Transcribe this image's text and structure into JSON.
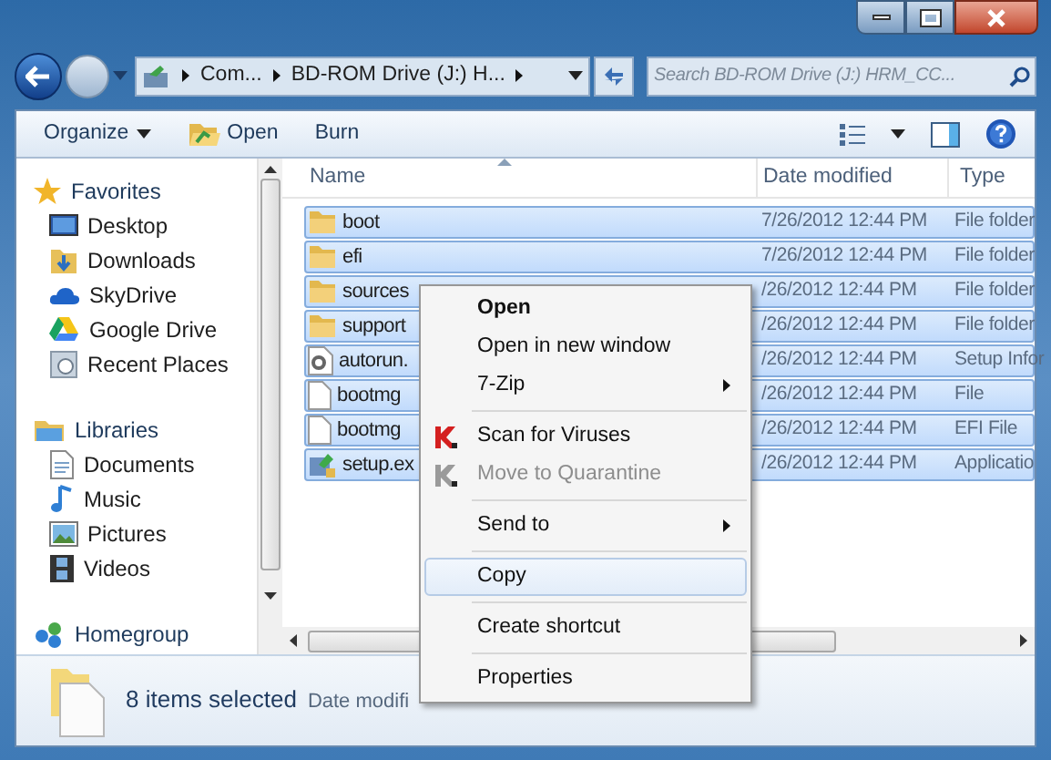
{
  "address": {
    "crumbs": [
      "Com...",
      "BD-ROM Drive (J:) H..."
    ]
  },
  "search": {
    "placeholder": "Search BD-ROM Drive (J:) HRM_CC..."
  },
  "toolbar": {
    "buttons": [
      {
        "label": "Organize",
        "kind": "dropdown"
      },
      {
        "label": "Open",
        "kind": "open"
      },
      {
        "label": "Burn",
        "kind": "plain"
      }
    ]
  },
  "sidebar": {
    "groups": [
      {
        "label": "Favorites",
        "kind": "star",
        "items": [
          {
            "label": "Desktop",
            "kind": "desktop"
          },
          {
            "label": "Downloads",
            "kind": "downloads"
          },
          {
            "label": "SkyDrive",
            "kind": "cloud"
          },
          {
            "label": "Google Drive",
            "kind": "drive"
          },
          {
            "label": "Recent Places",
            "kind": "recent"
          }
        ]
      },
      {
        "label": "Libraries",
        "kind": "library",
        "items": [
          {
            "label": "Documents",
            "kind": "document"
          },
          {
            "label": "Music",
            "kind": "music"
          },
          {
            "label": "Pictures",
            "kind": "pictures"
          },
          {
            "label": "Videos",
            "kind": "videos"
          }
        ]
      },
      {
        "label": "Homegroup",
        "kind": "homegroup"
      }
    ]
  },
  "table": {
    "columns": [
      "Name",
      "Date modified",
      "Type"
    ],
    "rows": [
      {
        "name": "boot",
        "date": "7/26/2012 12:44 PM",
        "type": "File folder",
        "kind": "folder",
        "selected": true
      },
      {
        "name": "efi",
        "date": "7/26/2012 12:44 PM",
        "type": "File folder",
        "kind": "folder",
        "selected": true
      },
      {
        "name": "sources",
        "date": "/26/2012 12:44 PM",
        "type": "File folder",
        "kind": "folder",
        "selected": true
      },
      {
        "name": "support",
        "date": "/26/2012 12:44 PM",
        "type": "File folder",
        "kind": "folder",
        "selected": true
      },
      {
        "name": "autorun.",
        "date": "/26/2012 12:44 PM",
        "type": "Setup Infor",
        "kind": "settings",
        "selected": true
      },
      {
        "name": "bootmg",
        "date": "/26/2012 12:44 PM",
        "type": "File",
        "kind": "file",
        "selected": true
      },
      {
        "name": "bootmg",
        "date": "/26/2012 12:44 PM",
        "type": "EFI File",
        "kind": "file",
        "selected": true
      },
      {
        "name": "setup.ex",
        "date": "/26/2012 12:44 PM",
        "type": "Applicatio",
        "kind": "setup",
        "selected": true
      }
    ]
  },
  "context_menu": {
    "groups": [
      [
        {
          "label": "Open",
          "bold": true,
          "disabled": false,
          "submenu": false,
          "selected": false
        },
        {
          "label": "Open in new window",
          "bold": false,
          "disabled": false,
          "submenu": false,
          "selected": false
        },
        {
          "label": "7-Zip",
          "bold": false,
          "disabled": false,
          "submenu": true,
          "selected": false
        }
      ],
      [
        {
          "label": "Scan for Viruses",
          "bold": false,
          "disabled": false,
          "submenu": false,
          "selected": false,
          "kind": "shield"
        },
        {
          "label": "Move to Quarantine",
          "bold": false,
          "disabled": true,
          "submenu": false,
          "selected": false,
          "kind": "shield"
        }
      ],
      [
        {
          "label": "Send to",
          "bold": false,
          "disabled": false,
          "submenu": true,
          "selected": false
        }
      ],
      [
        {
          "label": "Copy",
          "bold": false,
          "disabled": false,
          "submenu": false,
          "selected": true
        }
      ],
      [
        {
          "label": "Create shortcut",
          "bold": false,
          "disabled": false,
          "submenu": false,
          "selected": false
        }
      ],
      [
        {
          "label": "Properties",
          "bold": false,
          "disabled": false,
          "submenu": false,
          "selected": false
        }
      ]
    ]
  },
  "status_bar": {
    "count": "8 items selected",
    "detail": "Date modifi"
  }
}
